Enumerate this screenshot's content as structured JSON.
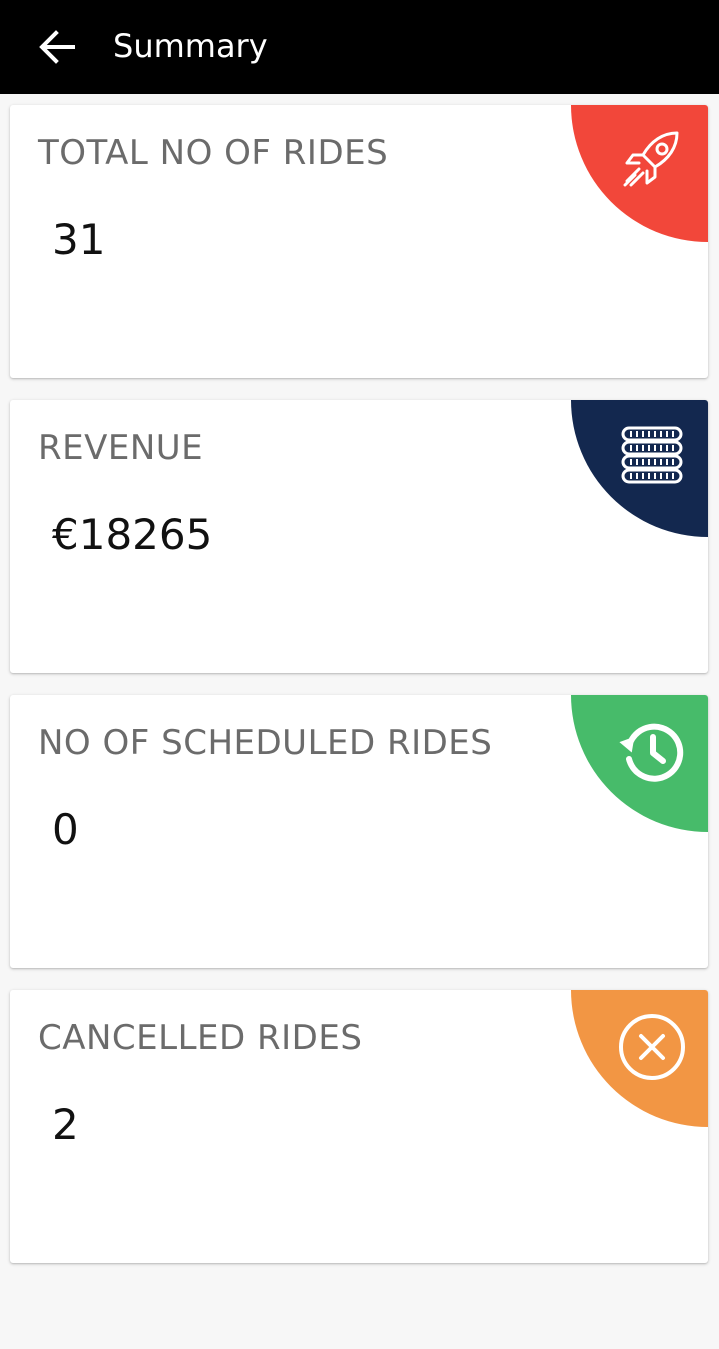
{
  "header": {
    "back_icon": "arrow-left-icon",
    "title": "Summary"
  },
  "cards": [
    {
      "label": "TOTAL NO OF RIDES",
      "value": "31",
      "icon": "rocket-icon",
      "color": "#f2473a"
    },
    {
      "label": "REVENUE",
      "value": "€18265",
      "icon": "coins-icon",
      "color": "#13284f"
    },
    {
      "label": "NO OF SCHEDULED RIDES",
      "value": "0",
      "icon": "history-icon",
      "color": "#47bb6a"
    },
    {
      "label": "CANCELLED RIDES",
      "value": "2",
      "icon": "cancel-circle-icon",
      "color": "#f29644"
    }
  ]
}
